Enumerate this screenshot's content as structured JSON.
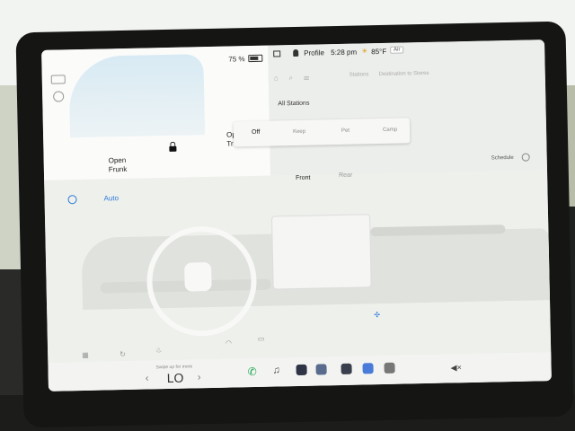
{
  "status": {
    "battery": "75 %",
    "profile": "Profile",
    "time": "5:28 pm",
    "temperature": "85°F",
    "air": "Air"
  },
  "car": {
    "frunk": "Open\nFrunk",
    "trunk": "Open\nTr"
  },
  "nav": {
    "tab_stations": "Stations",
    "tab_destinations": "Destination to Stores",
    "list_title": "All Stations"
  },
  "climate_popup": {
    "options": [
      "Off",
      "Keep",
      "Pet",
      "Camp"
    ]
  },
  "climate": {
    "auto": "Auto",
    "front": "Front",
    "rear": "Rear",
    "schedule": "Schedule",
    "temp": "LO",
    "temp_caption": "Swipe up for more"
  },
  "icons": [
    "car-icon",
    "battery-icon",
    "lock-icon",
    "profile-icon",
    "power-icon",
    "phone-icon",
    "music-icon",
    "camera-icon",
    "volume-icon"
  ]
}
